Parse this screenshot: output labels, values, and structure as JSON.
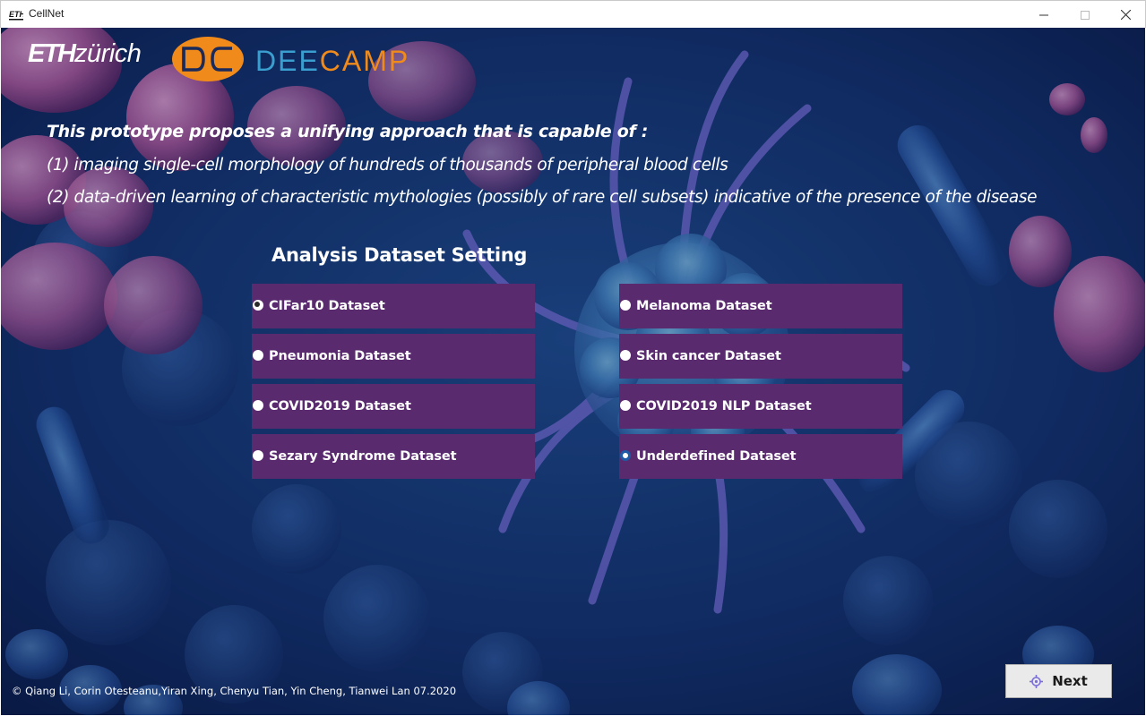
{
  "window": {
    "title": "CellNet",
    "icon_text": "ETH"
  },
  "brand": {
    "eth_bold": "ETH",
    "eth_rest": "zürich",
    "deecamp_dee": "DEE",
    "deecamp_camp": "CAMP",
    "badge_icon": "dc-badge-icon"
  },
  "intro": {
    "line1": "This prototype proposes a unifying approach that is capable of :",
    "line2": "(1) imaging single-cell morphology of hundreds of thousands of peripheral blood cells",
    "line3": "(2) data-driven learning of characteristic mythologies (possibly of rare cell subsets) indicative of the presence of the disease"
  },
  "section": {
    "title": "Analysis Dataset Setting"
  },
  "datasets": [
    {
      "label": "CIFar10 Dataset",
      "state": "focused"
    },
    {
      "label": "Melanoma Dataset",
      "state": "unchecked"
    },
    {
      "label": "Pneumonia Dataset",
      "state": "unchecked"
    },
    {
      "label": "Skin cancer Dataset",
      "state": "unchecked"
    },
    {
      "label": "COVID2019 Dataset",
      "state": "unchecked"
    },
    {
      "label": "COVID2019 NLP Dataset",
      "state": "unchecked"
    },
    {
      "label": "Sezary Syndrome Dataset",
      "state": "unchecked"
    },
    {
      "label": "Underdefined  Dataset",
      "state": "checked"
    }
  ],
  "footer": {
    "credits": "© Qiang Li, Corin Otesteanu,Yiran Xing, Chenyu Tian, Yin Cheng, Tianwei Lan 07.2020"
  },
  "next_button": {
    "label": "Next",
    "icon": "crosshair-icon"
  },
  "colors": {
    "option_bg": "#5a2a6f",
    "background": "#0d1f4d",
    "dee_blue": "#3a9fcf",
    "camp_orange": "#f08a1a"
  }
}
